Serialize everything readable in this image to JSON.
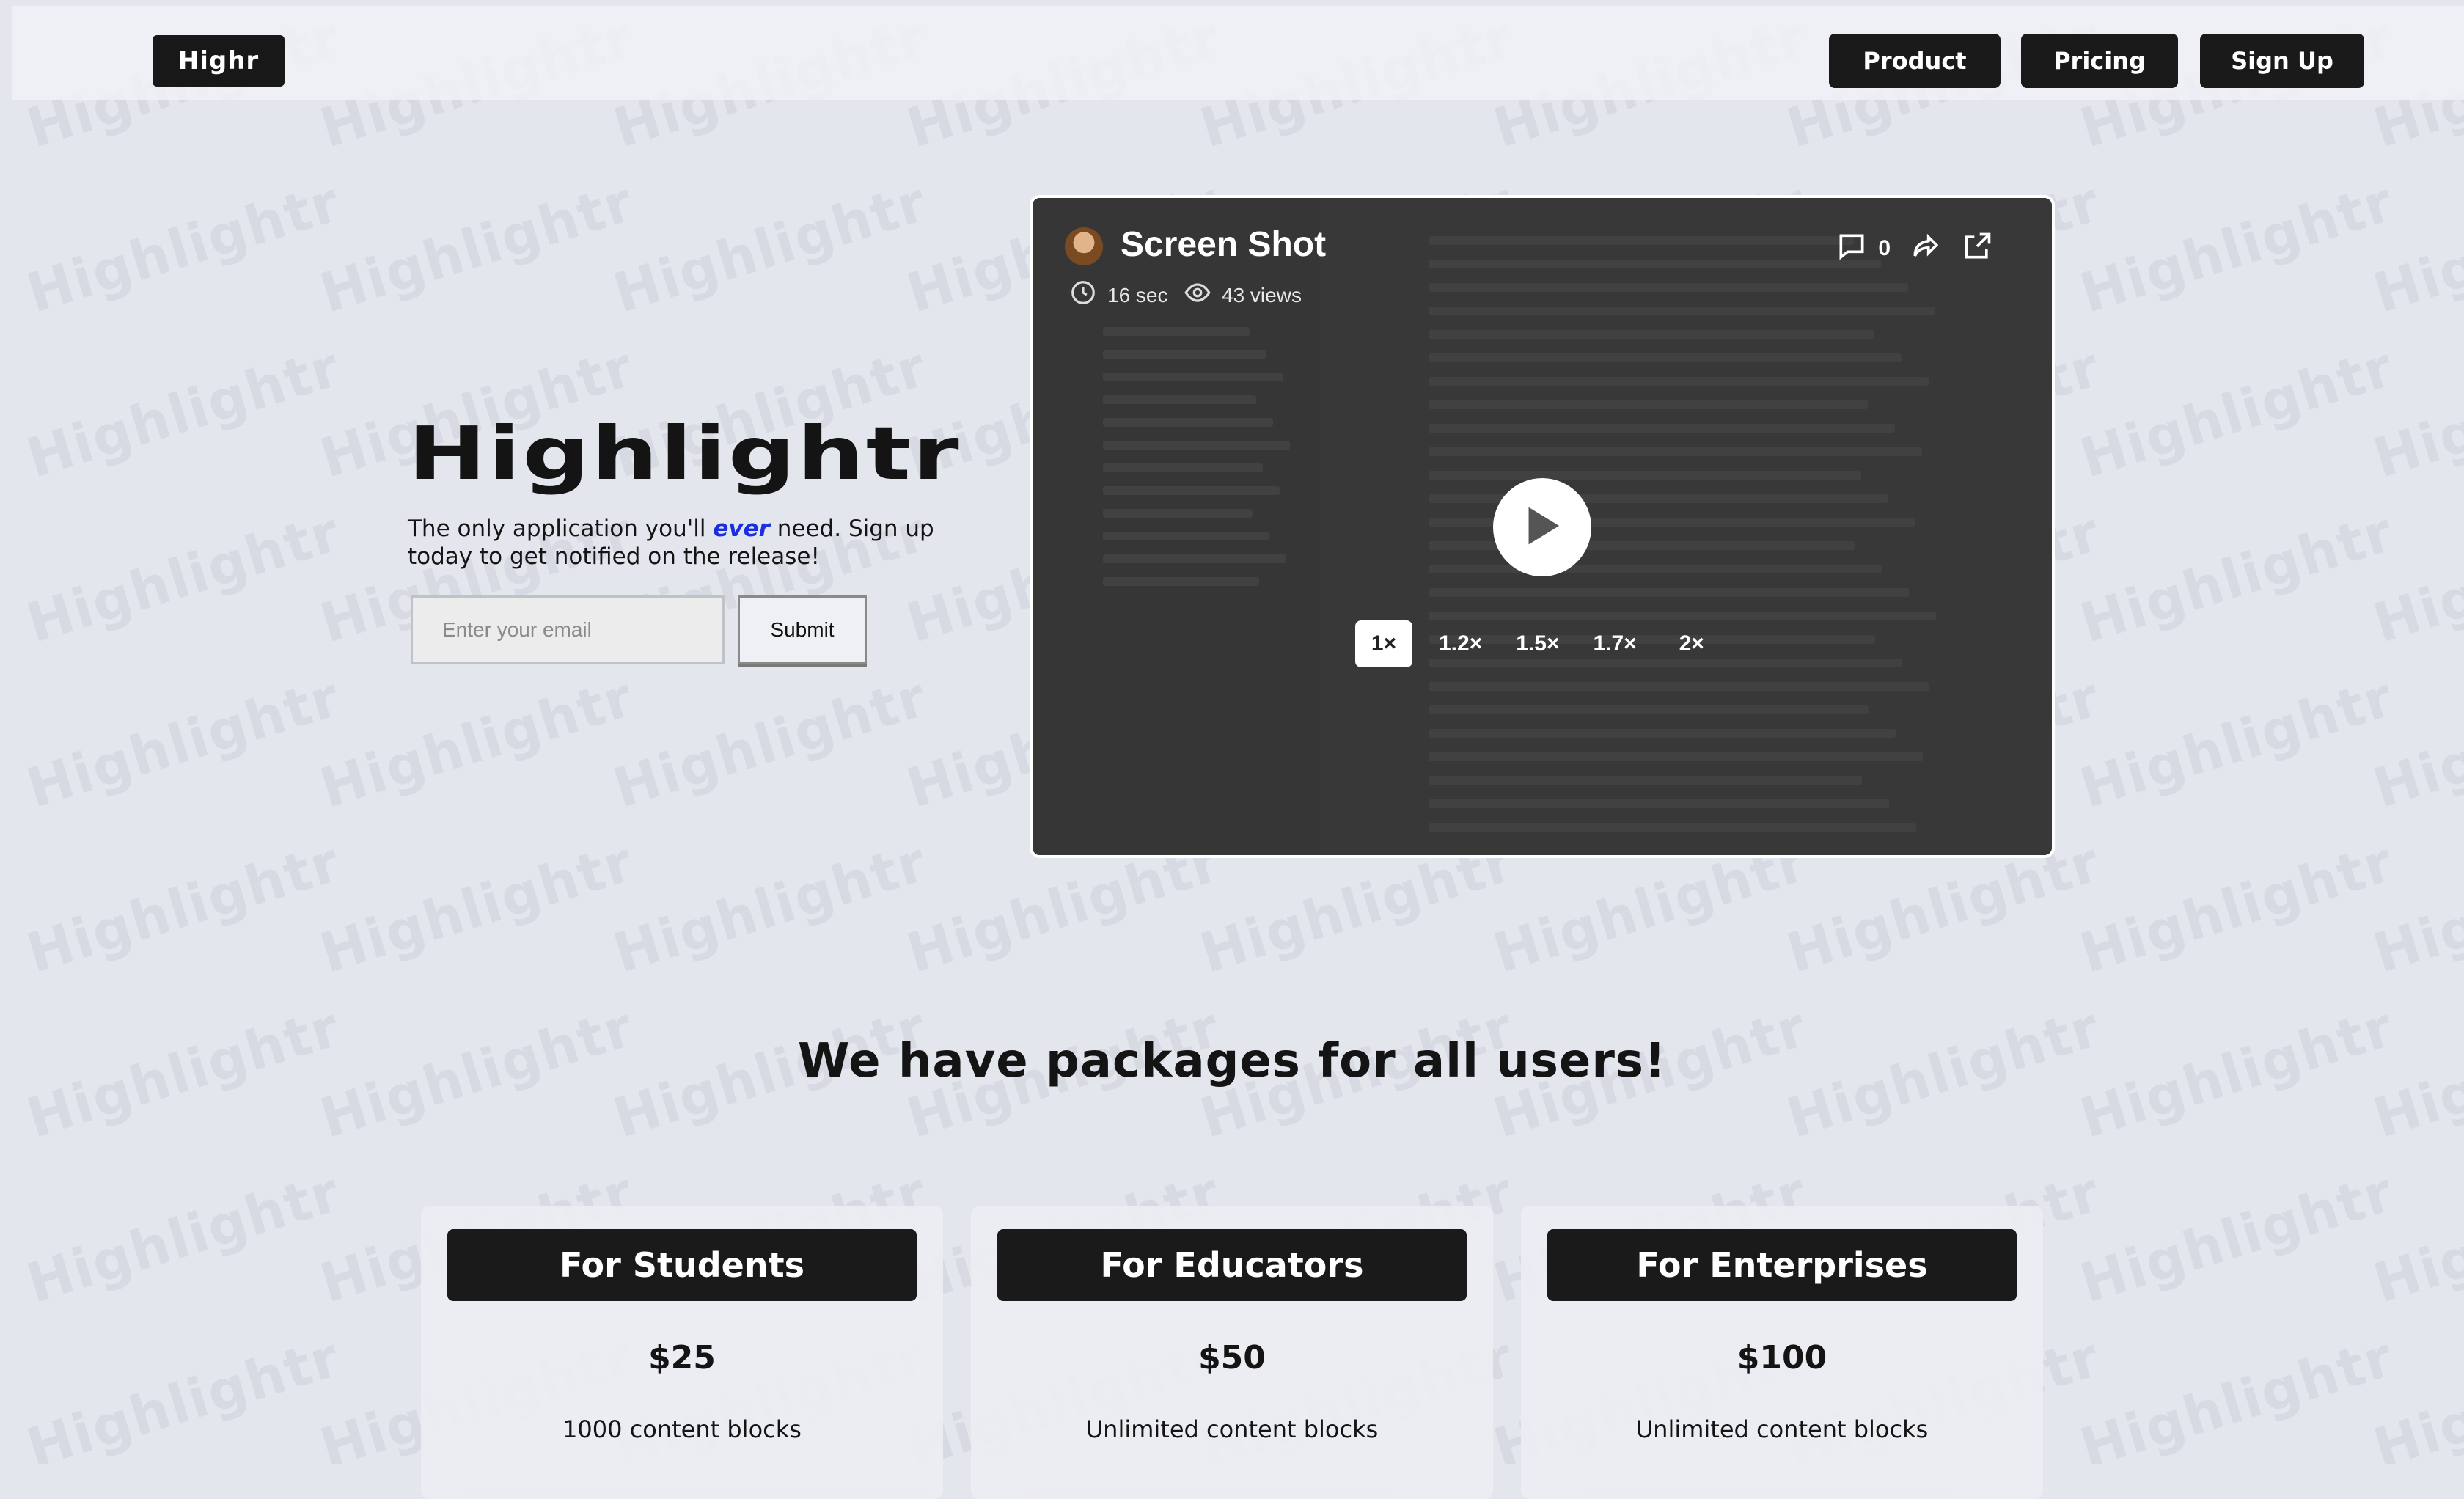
{
  "nav": {
    "logo": "Highr",
    "product": "Product",
    "pricing": "Pricing",
    "signup": "Sign Up"
  },
  "hero": {
    "title": "Highlightr",
    "tagline_before": "The only application you'll ",
    "tagline_emphasis": "ever",
    "tagline_after": " need. Sign up today to get notified on the release!",
    "email_placeholder": "Enter your email",
    "submit": "Submit"
  },
  "video": {
    "title": "Screen Shot",
    "duration": "16 sec",
    "views": "43 views",
    "comments": "0",
    "speeds": [
      "1×",
      "1.2×",
      "1.5×",
      "1.7×",
      "2×"
    ],
    "active_speed": "1×"
  },
  "packages": {
    "title": "We have packages for all users!",
    "cards": [
      {
        "name": "For Students",
        "price": "$25",
        "feature": "1000 content blocks"
      },
      {
        "name": "For Educators",
        "price": "$50",
        "feature": "Unlimited content blocks"
      },
      {
        "name": "For Enterprises",
        "price": "$100",
        "feature": "Unlimited content blocks"
      }
    ]
  },
  "watermark": "Highlightr",
  "colors": {
    "background": "#e4e6ee",
    "dark": "#1a1a1a",
    "accent": "#1b2fe0",
    "video_bg": "#3d3d3d"
  }
}
